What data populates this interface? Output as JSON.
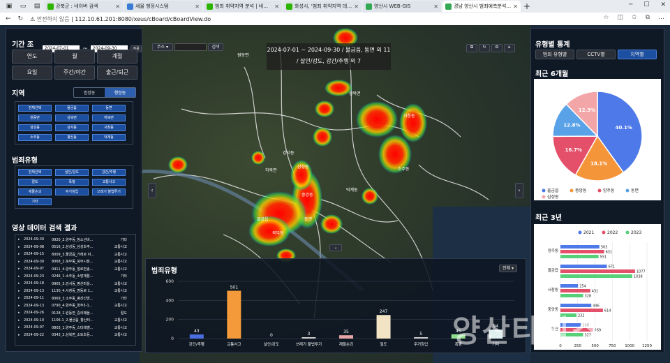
{
  "browser": {
    "tabs": [
      {
        "title": "강북군 : 네이버 검색",
        "color": "#2db400"
      },
      {
        "title": "새올 행정시스템",
        "color": "#3a7bd5"
      },
      {
        "title": "범죄 취약지역 분석 | 네이버 검색",
        "color": "#2db400"
      },
      {
        "title": "화성시, '범죄 취약지역 데이터 분",
        "color": "#2db400"
      },
      {
        "title": "양산시 WEB-GIS",
        "color": "#34a853"
      },
      {
        "title": "경남 양산시 범죄예측분석지도",
        "color": "#34a853"
      }
    ],
    "url_warning": "안전하지 않음",
    "url": "112.10.61.201:8080/xeus/cBoard/cBoardView.do"
  },
  "left": {
    "period_title": "기간 조회",
    "date_from": "2024-07-01",
    "date_to": "2024-09-30",
    "apply": "적용",
    "period_buttons": [
      "연도",
      "월",
      "계절",
      "요일",
      "주간/야간",
      "출근/퇴근"
    ],
    "region_title": "지역",
    "region_tabs": [
      "법정동",
      "행정동"
    ],
    "regions": [
      "전체선택",
      "물금읍",
      "동면",
      "원동면",
      "상북면",
      "하북면",
      "삼성동",
      "강서동",
      "서창동",
      "소주동",
      "평산동",
      "덕계동"
    ],
    "crime_title": "범죄유형",
    "crimes": [
      "전체선택",
      "살인/강도",
      "강간/추행",
      "절도",
      "폭행",
      "교통사고",
      "재물손괴",
      "주거침입",
      "쓰레기 불법투기",
      "기타"
    ],
    "results_title": "영상 데이터 검색 결과",
    "results": [
      {
        "date": "2024-09-30",
        "title": "0920_2.양주동_청소년비...",
        "type": "기타"
      },
      {
        "date": "2024-09-08",
        "title": "0516_2.삼성동_삼성초주...",
        "type": "교통사고"
      },
      {
        "date": "2024-09-15",
        "title": "8009_3.물금읍_가례로 야...",
        "type": "교통사고"
      },
      {
        "date": "2024-09-30",
        "title": "8068_2.북부동_북부시장...",
        "type": "교통사고"
      },
      {
        "date": "2024-09-07",
        "title": "0411_4.양주동_철로면송...",
        "type": "교통사고"
      },
      {
        "date": "2024-09-23",
        "title": "0246_1.소주동_소방재활...",
        "type": "기타"
      },
      {
        "date": "2024-09-18",
        "title": "0905_3.강서동_평산마을...",
        "type": "교통사고"
      },
      {
        "date": "2024-09-13",
        "title": "1130_4.서창동_명동로 1...",
        "type": "교통사고"
      },
      {
        "date": "2024-09-11",
        "title": "8069_3.소주동_평산선방...",
        "type": "기타"
      },
      {
        "date": "2024-09-13",
        "title": "0790_4.양주동_양주5-1...",
        "type": "교통사고"
      },
      {
        "date": "2024-09-26",
        "title": "0128_2.원동면_중리때을...",
        "type": "절도"
      },
      {
        "date": "2024-09-10",
        "title": "1106-1_2.물금읍_황산터...",
        "type": "교통사고"
      },
      {
        "date": "2024-09-07",
        "title": "0803_1.양주동_스타레벨...",
        "type": "교통사고"
      },
      {
        "date": "2024-09-22",
        "title": "0343_2.상북면_소토초등...",
        "type": "교통사고"
      }
    ]
  },
  "map": {
    "search_sel": "주소",
    "search_btn": "검색",
    "info_line1": "2024-07-01 ~ 2024-09-30  / 물금읍, 동면 외 11",
    "info_line2": "/ 살인/강도, 강간/추행 외 7",
    "labels": [
      "원동면",
      "상북면",
      "하북면",
      "서창동",
      "강서동",
      "물금읍",
      "중앙동",
      "동면",
      "삼성동",
      "소주동",
      "덕계동",
      "북부동"
    ]
  },
  "bottom": {
    "title": "범죄유형",
    "select": "전체",
    "chart_data": {
      "type": "bar",
      "categories": [
        "강간/추행",
        "교통사고",
        "살인/강도",
        "쓰레기 불법투기",
        "재물손괴",
        "절도",
        "주거침입",
        "폭행",
        "기타"
      ],
      "values": [
        43,
        501,
        0,
        3,
        35,
        247,
        5,
        45,
        94
      ],
      "colors": [
        "#4a6ee0",
        "#f59a3a",
        "#cccccc",
        "#cccccc",
        "#e6a6a8",
        "#f2e3c4",
        "#cccccc",
        "#8fe08f",
        "#e0f0f0"
      ],
      "ylim": [
        0,
        600
      ],
      "yticks": [
        0,
        200,
        400,
        600
      ]
    }
  },
  "right": {
    "title": "유형별 통계",
    "tabs": [
      "범죄 유형별",
      "CCTV별",
      "지역별"
    ],
    "pie_title": "최근 6개월",
    "pie_data": {
      "type": "pie",
      "labels": [
        "물금읍",
        "중앙동",
        "양주동",
        "동면",
        "삼성동"
      ],
      "values": [
        40.1,
        18.1,
        16.7,
        12.8,
        12.3
      ],
      "colors": [
        "#4e79e8",
        "#f5953a",
        "#e4506a",
        "#5aa2e8",
        "#f2a6a8"
      ]
    },
    "bar_title": "최근 3년",
    "bar_data": {
      "type": "bar",
      "series": [
        {
          "name": "2021",
          "color": "#4e79e8"
        },
        {
          "name": "2022",
          "color": "#e4506a"
        },
        {
          "name": "2023",
          "color": "#57d07a"
        }
      ],
      "categories": [
        "양주동",
        "물금읍",
        "서창동",
        "중앙동",
        "동면"
      ],
      "values": [
        [
          563,
          631,
          551
        ],
        [
          671,
          1077,
          1038
        ],
        [
          254,
          431,
          328
        ],
        [
          446,
          614,
          232
        ],
        [
          296,
          469,
          327
        ]
      ],
      "xlim": [
        0,
        1250
      ],
      "xticks": [
        0,
        250,
        500,
        750,
        1000,
        1250
      ]
    }
  },
  "watermark": "양산타임스"
}
